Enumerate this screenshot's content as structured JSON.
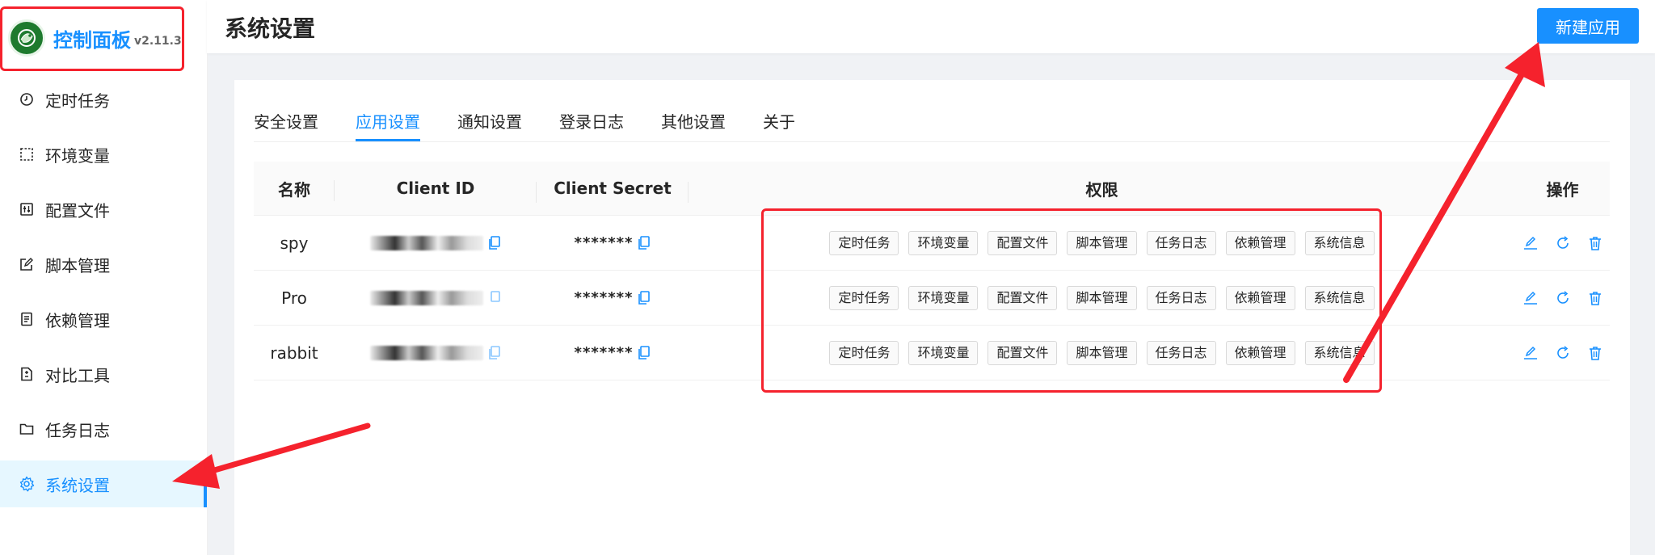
{
  "app": {
    "title": "控制面板",
    "version": "v2.11.3"
  },
  "sidebar": {
    "items": [
      {
        "label": "定时任务",
        "icon": "clock-icon",
        "active": false
      },
      {
        "label": "环境变量",
        "icon": "dashed-box-icon",
        "active": false
      },
      {
        "label": "配置文件",
        "icon": "sliders-icon",
        "active": false
      },
      {
        "label": "脚本管理",
        "icon": "edit-icon",
        "active": false
      },
      {
        "label": "依赖管理",
        "icon": "file-list-icon",
        "active": false
      },
      {
        "label": "对比工具",
        "icon": "diff-file-icon",
        "active": false
      },
      {
        "label": "任务日志",
        "icon": "folder-icon",
        "active": false
      },
      {
        "label": "系统设置",
        "icon": "gear-icon",
        "active": true
      }
    ]
  },
  "header": {
    "title": "系统设置",
    "new_button": "新建应用"
  },
  "tabs": [
    {
      "label": "安全设置",
      "active": false
    },
    {
      "label": "应用设置",
      "active": true
    },
    {
      "label": "通知设置",
      "active": false
    },
    {
      "label": "登录日志",
      "active": false
    },
    {
      "label": "其他设置",
      "active": false
    },
    {
      "label": "关于",
      "active": false
    }
  ],
  "table": {
    "columns": [
      "名称",
      "Client ID",
      "Client Secret",
      "权限",
      "操作"
    ],
    "rows": [
      {
        "name": "spy",
        "secret": "*******",
        "permissions": [
          "定时任务",
          "环境变量",
          "配置文件",
          "脚本管理",
          "任务日志",
          "依赖管理",
          "系统信息"
        ]
      },
      {
        "name": "Pro",
        "secret": "*******",
        "permissions": [
          "定时任务",
          "环境变量",
          "配置文件",
          "脚本管理",
          "任务日志",
          "依赖管理",
          "系统信息"
        ]
      },
      {
        "name": "rabbit",
        "secret": "*******",
        "permissions": [
          "定时任务",
          "环境变量",
          "配置文件",
          "脚本管理",
          "任务日志",
          "依赖管理",
          "系统信息"
        ]
      }
    ]
  },
  "colors": {
    "primary": "#1890ff",
    "annotation": "#f5222d",
    "active_bg": "#e6f7ff"
  }
}
